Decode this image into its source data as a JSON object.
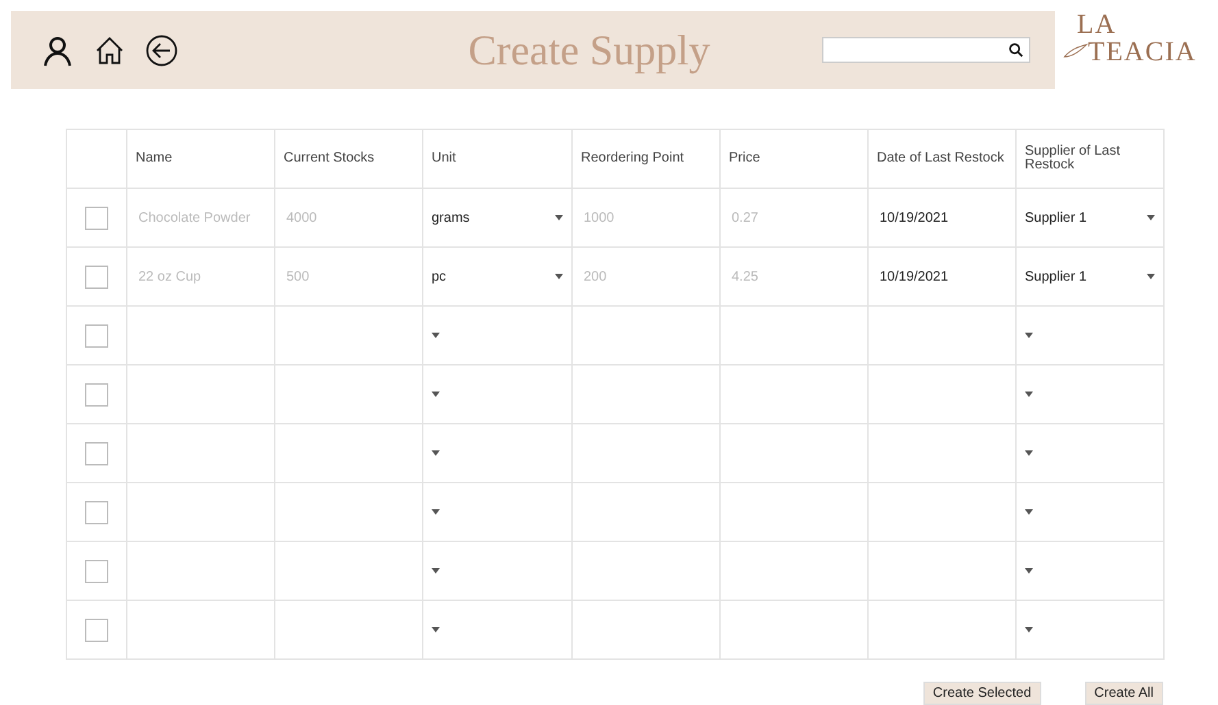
{
  "header": {
    "title": "Create Supply",
    "logo": {
      "top": "LA",
      "bottom": "TEACIA"
    }
  },
  "table": {
    "columns": [
      "Name",
      "Current Stocks",
      "Unit",
      "Reordering Point",
      "Price",
      "Date of Last Restock",
      "Supplier of Last Restock"
    ],
    "rows": [
      {
        "checked": false,
        "name": {
          "placeholder": "Chocolate Powder"
        },
        "stocks": {
          "placeholder": "4000"
        },
        "unit": "grams",
        "reorder": {
          "placeholder": "1000"
        },
        "price": {
          "placeholder": "0.27"
        },
        "date": "10/19/2021",
        "supplier": "Supplier 1"
      },
      {
        "checked": false,
        "name": {
          "placeholder": "22 oz Cup"
        },
        "stocks": {
          "placeholder": "500"
        },
        "unit": "pc",
        "reorder": {
          "placeholder": "200"
        },
        "price": {
          "placeholder": "4.25"
        },
        "date": "10/19/2021",
        "supplier": "Supplier 1"
      },
      {
        "checked": false
      },
      {
        "checked": false
      },
      {
        "checked": false
      },
      {
        "checked": false
      },
      {
        "checked": false
      },
      {
        "checked": false
      }
    ]
  },
  "buttons": [
    "Create Selected",
    "Create All"
  ]
}
